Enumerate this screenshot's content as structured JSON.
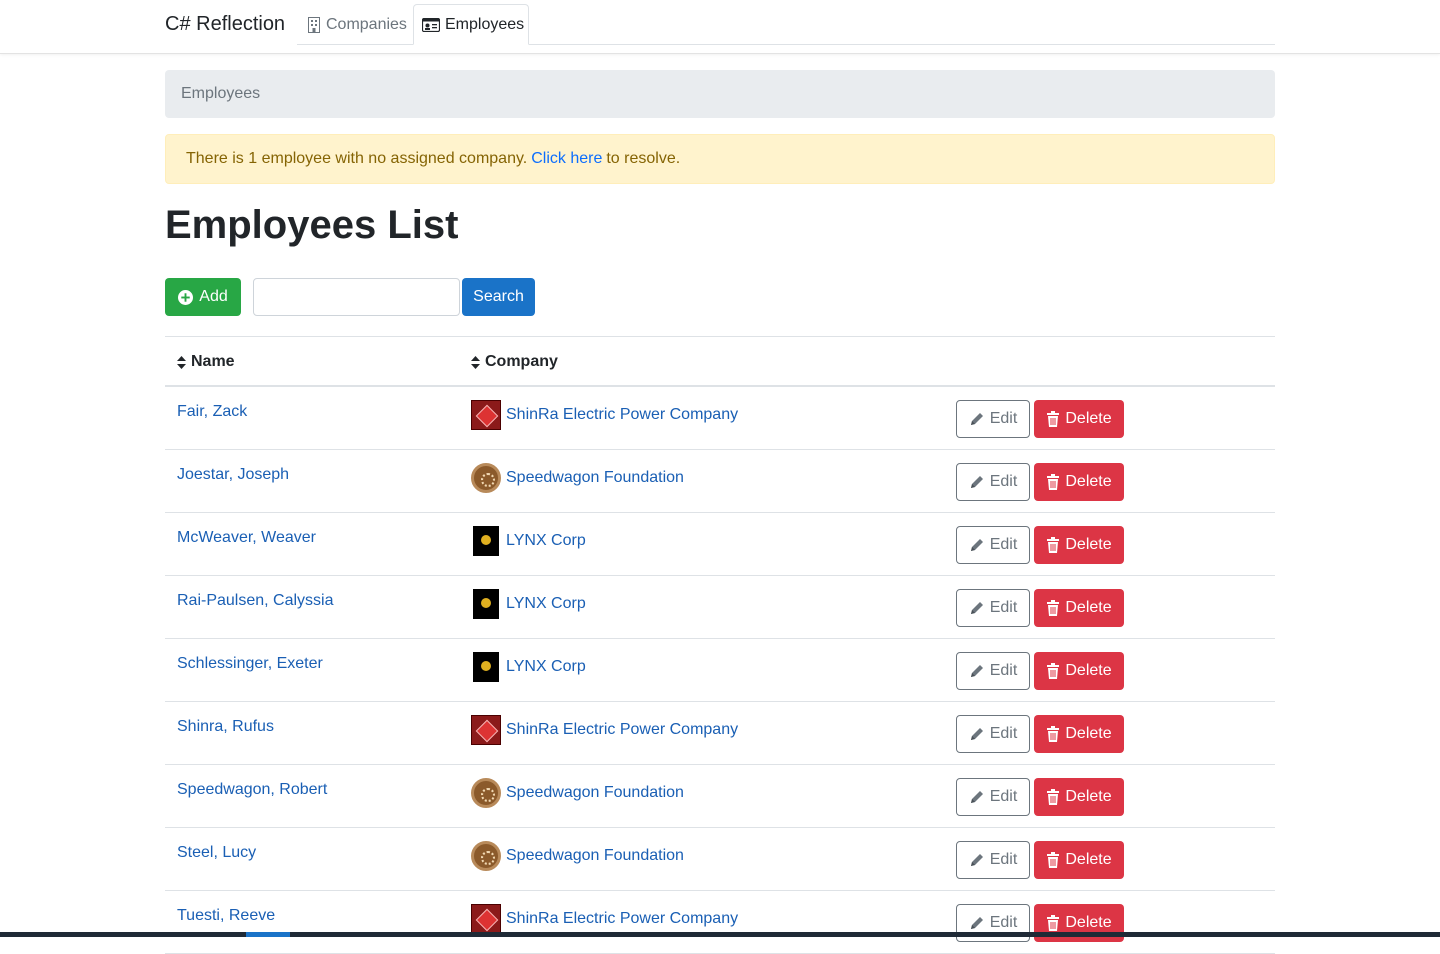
{
  "nav": {
    "brand": "C# Reflection",
    "tabs": [
      {
        "label": "Companies",
        "icon": "building-icon",
        "active": false
      },
      {
        "label": "Employees",
        "icon": "id-card-icon",
        "active": true
      }
    ]
  },
  "breadcrumb": {
    "current": "Employees"
  },
  "alert": {
    "prefix": "There is 1 employee with no assigned company.",
    "link": "Click here",
    "suffix": "to resolve."
  },
  "page": {
    "title": "Employees List"
  },
  "toolbar": {
    "add_label": "Add",
    "search_value": "",
    "search_placeholder": "",
    "search_label": "Search"
  },
  "table": {
    "columns": [
      "Name",
      "Company"
    ],
    "rows": [
      {
        "name": "Fair, Zack",
        "company": "ShinRa Electric Power Company",
        "logo": "shinra",
        "edit": "Edit",
        "delete": "Delete"
      },
      {
        "name": "Joestar, Joseph",
        "company": "Speedwagon Foundation",
        "logo": "speedwagon",
        "edit": "Edit",
        "delete": "Delete"
      },
      {
        "name": "McWeaver, Weaver",
        "company": "LYNX Corp",
        "logo": "lynx",
        "edit": "Edit",
        "delete": "Delete"
      },
      {
        "name": "Rai-Paulsen, Calyssia",
        "company": "LYNX Corp",
        "logo": "lynx",
        "edit": "Edit",
        "delete": "Delete"
      },
      {
        "name": "Schlessinger, Exeter",
        "company": "LYNX Corp",
        "logo": "lynx",
        "edit": "Edit",
        "delete": "Delete"
      },
      {
        "name": "Shinra, Rufus",
        "company": "ShinRa Electric Power Company",
        "logo": "shinra",
        "edit": "Edit",
        "delete": "Delete"
      },
      {
        "name": "Speedwagon, Robert",
        "company": "Speedwagon Foundation",
        "logo": "speedwagon",
        "edit": "Edit",
        "delete": "Delete"
      },
      {
        "name": "Steel, Lucy",
        "company": "Speedwagon Foundation",
        "logo": "speedwagon",
        "edit": "Edit",
        "delete": "Delete"
      },
      {
        "name": "Tuesti, Reeve",
        "company": "ShinRa Electric Power Company",
        "logo": "shinra",
        "edit": "Edit",
        "delete": "Delete"
      }
    ]
  },
  "colors": {
    "primary": "#1a73c8",
    "success": "#28a745",
    "danger": "#dc3545",
    "link": "#1a5fb4",
    "alert_bg": "#fff3cd"
  }
}
